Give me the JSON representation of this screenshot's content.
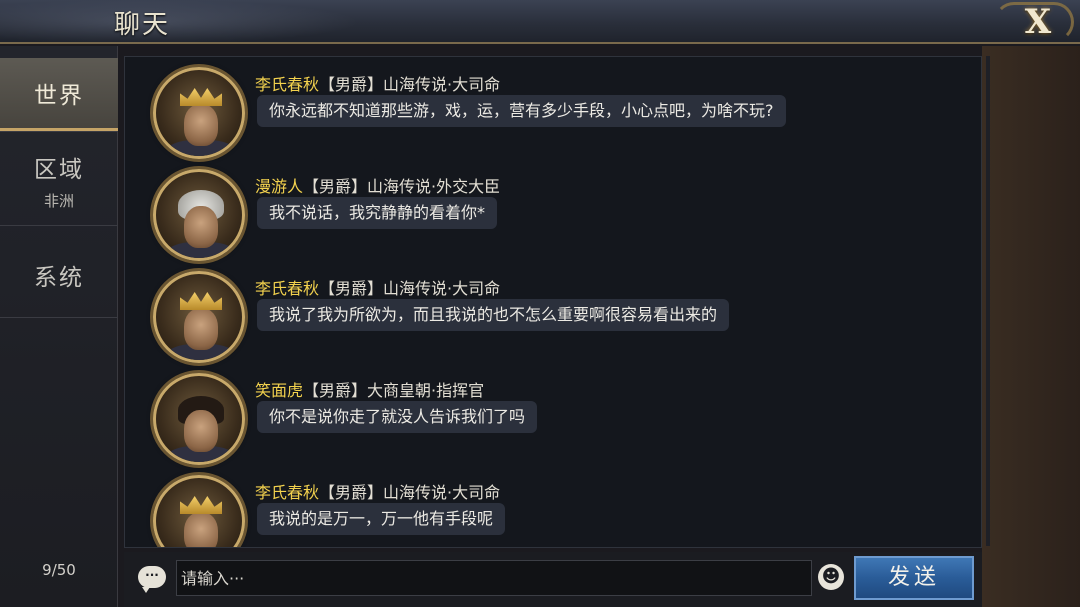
{
  "header": {
    "title": "聊天",
    "close_icon": "X"
  },
  "tabs": [
    {
      "label": "世界",
      "sub": ""
    },
    {
      "label": "区域",
      "sub": "非洲"
    },
    {
      "label": "系统",
      "sub": ""
    }
  ],
  "message_count": "9/50",
  "messages": [
    {
      "nick": "李氏春秋",
      "rank": "【男爵】山海传说·大司命",
      "text": "你永远都不知道那些游，戏，运，营有多少手段，小心点吧，为啥不玩?"
    },
    {
      "nick": "漫游人",
      "rank": "【男爵】山海传说·外交大臣",
      "text": "我不说话，我究静静的看着你*"
    },
    {
      "nick": "李氏春秋",
      "rank": "【男爵】山海传说·大司命",
      "text": "我说了我为所欲为，而且我说的也不怎么重要啊很容易看出来的"
    },
    {
      "nick": "笑面虎",
      "rank": "【男爵】大商皇朝·指挥官",
      "text": "你不是说你走了就没人告诉我们了吗"
    },
    {
      "nick": "李氏春秋",
      "rank": "【男爵】山海传说·大司命",
      "text": "我说的是万一，万一他有手段呢"
    }
  ],
  "input": {
    "placeholder": "请输入···",
    "send_label": "发送"
  },
  "colors": {
    "nick": "#f3d24e",
    "send_button": "#2a5c98",
    "bubble": "#2b303c"
  },
  "icons": {
    "chat": "speech-bubble-icon",
    "emoji": "smiley-icon",
    "close": "close-icon"
  }
}
